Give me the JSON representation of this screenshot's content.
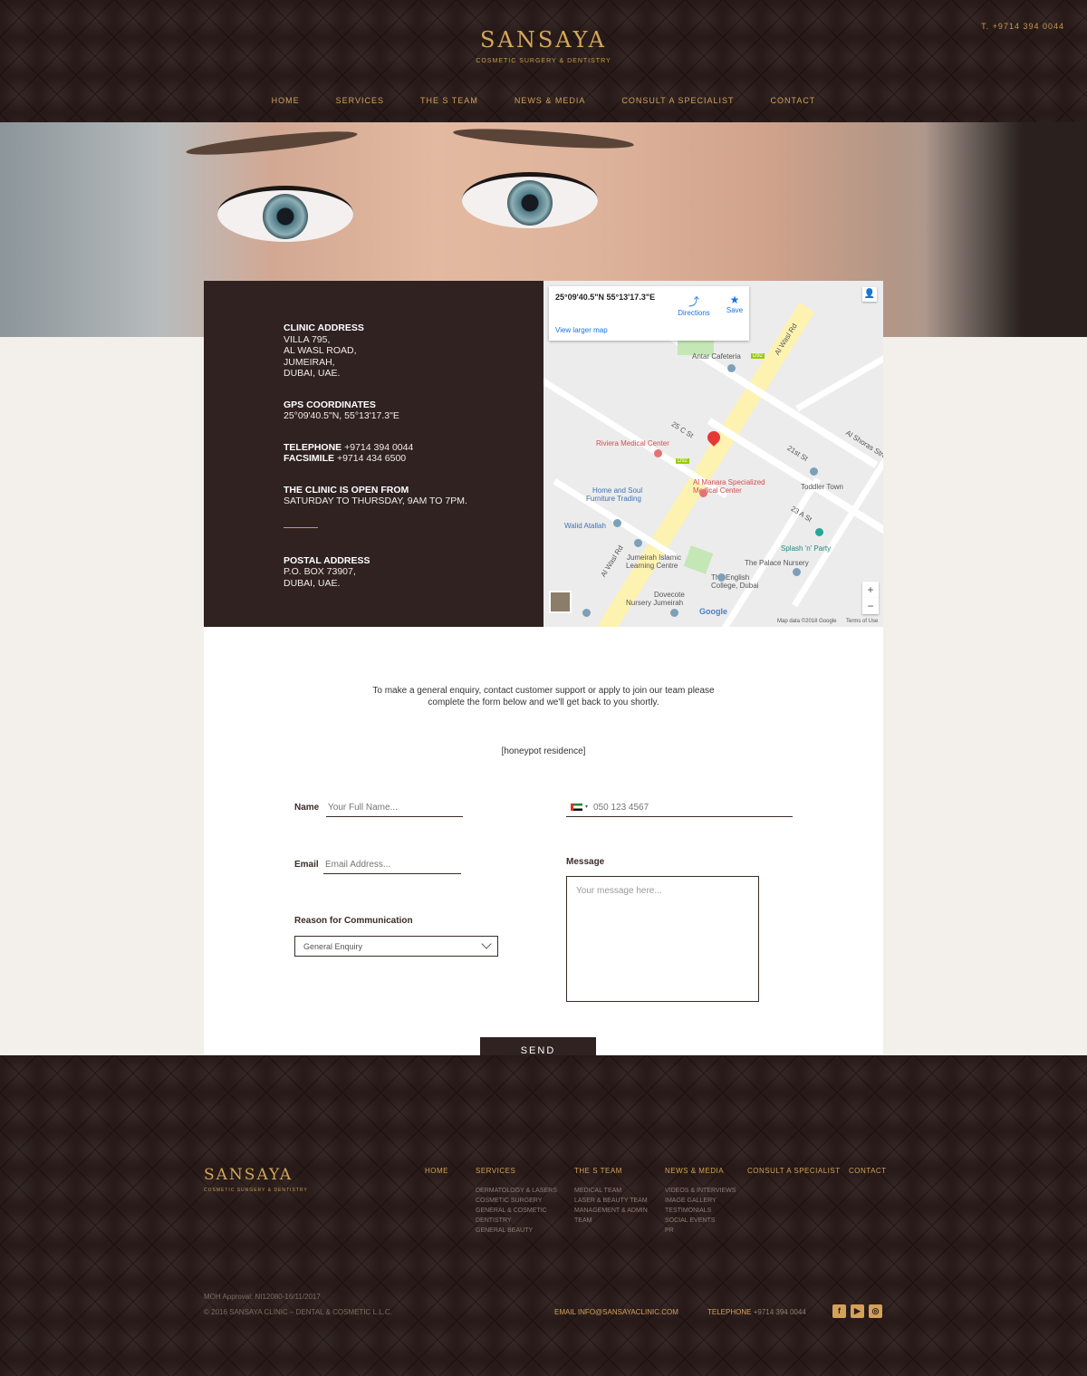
{
  "header": {
    "logo_text": "SANSAYA",
    "logo_tagline": "COSMETIC SURGERY & DENTISTRY",
    "phone": "T. +9714 394 0044",
    "nav": [
      {
        "label": "HOME"
      },
      {
        "label": "SERVICES"
      },
      {
        "label": "THE S TEAM"
      },
      {
        "label": "NEWS & MEDIA"
      },
      {
        "label": "CONSULT A SPECIALIST"
      },
      {
        "label": "CONTACT"
      }
    ]
  },
  "info": {
    "clinic_title": "CLINIC ADDRESS",
    "clinic_lines": [
      "VILLA 795,",
      "AL WASL ROAD,",
      "JUMEIRAH,",
      "DUBAI, UAE."
    ],
    "gps_title": "GPS COORDINATES",
    "gps_value": "25°09'40.5\"N, 55°13'17.3\"E",
    "tel_label": "TELEPHONE",
    "tel_value": "+9714 394 0044",
    "fax_label": "FACSIMILE",
    "fax_value": "+9714 434 6500",
    "hours_title": "THE CLINIC IS OPEN FROM",
    "hours_value": "SATURDAY TO THURSDAY, 9AM TO 7PM.",
    "postal_title": "POSTAL ADDRESS",
    "postal_lines": [
      "P.O. BOX 73907,",
      "DUBAI, UAE."
    ]
  },
  "map": {
    "coords": "25°09'40.5\"N 55°13'17.3\"E",
    "directions": "Directions",
    "save": "Save",
    "larger_map": "View larger map",
    "attribution": "Map data ©2018 Google",
    "terms": "Terms of Use",
    "google": "Google",
    "labels": {
      "antar": "Antar Cafeteria",
      "riviera": "Riviera Medical Center",
      "almanara1": "Al Manara Specialized",
      "almanara2": "Medical Center",
      "homesoul1": "Home and Soul",
      "homesoul2": "Furniture Trading",
      "toddler": "Toddler Town",
      "walid": "Walid Atallah",
      "splash": "Splash 'n' Party",
      "palace": "The Palace Nursery",
      "jumeirah1": "Jumeirah Islamic",
      "jumeirah2": "Learning Centre",
      "english1": "The English",
      "english2": "College, Dubai",
      "dovecote1": "Dovecote",
      "dovecote2": "Nursery Jumeirah",
      "alwasl1": "Al Wasl Rd",
      "alwasl2": "Al Wasl Rd",
      "c25": "25 C St",
      "st21": "21st St",
      "a23": "23 A St",
      "shoras": "Al Shoras Street",
      "d92a": "D92",
      "d92b": "D92"
    }
  },
  "form": {
    "intro_line1": "To make a general enquiry, contact customer support or apply to join our team please",
    "intro_line2": "complete the form below and we'll get back to you shortly.",
    "honeypot": "[honeypot residence]",
    "name_label": "Name",
    "name_placeholder": "Your Full Name...",
    "phone_placeholder": "050 123 4567",
    "email_label": "Email",
    "email_placeholder": "Email Address...",
    "message_label": "Message",
    "message_placeholder": "Your message here...",
    "reason_label": "Reason for Communication",
    "reason_selected": "General Enquiry",
    "send": "SEND"
  },
  "footer": {
    "logo_text": "SANSAYA",
    "logo_tagline": "COSMETIC SURGERY & DENTISTRY",
    "cols": {
      "home": {
        "title": "HOME"
      },
      "services": {
        "title": "SERVICES",
        "items": [
          "DERMATOLOGY & LASERS",
          "COSMETIC SURGERY",
          "GENERAL & COSMETIC",
          "DENTISTRY",
          "GENERAL BEAUTY"
        ]
      },
      "team": {
        "title": "THE S TEAM",
        "items": [
          "MEDICAL TEAM",
          "LASER & BEAUTY TEAM",
          "MANAGEMENT & ADMIN",
          "TEAM"
        ]
      },
      "news": {
        "title": "NEWS & MEDIA",
        "items": [
          "VIDEOS & INTERVIEWS",
          "IMAGE GALLERY",
          "TESTIMONIALS",
          "SOCIAL EVENTS",
          "PR"
        ]
      },
      "consult": {
        "title": "CONSULT A SPECIALIST"
      },
      "contact": {
        "title": "CONTACT"
      }
    },
    "moh": "MOH Approval: NI12080-16/11/2017",
    "copyright": "© 2016   SANSAYA CLINIC – DENTAL & COSMETIC L.L.C.",
    "email": "EMAIL INFO@SANSAYACLINIC.COM",
    "telephone_label": "TELEPHONE",
    "telephone_value": "+9714 394 0044",
    "social": [
      {
        "icon": "facebook-icon",
        "glyph": "f"
      },
      {
        "icon": "youtube-icon",
        "glyph": "▶"
      },
      {
        "icon": "instagram-icon",
        "glyph": "◎"
      }
    ]
  },
  "colors": {
    "gold": "#d4a15a",
    "dark_brown": "#2f2221",
    "cream": "#f3f0eb"
  }
}
